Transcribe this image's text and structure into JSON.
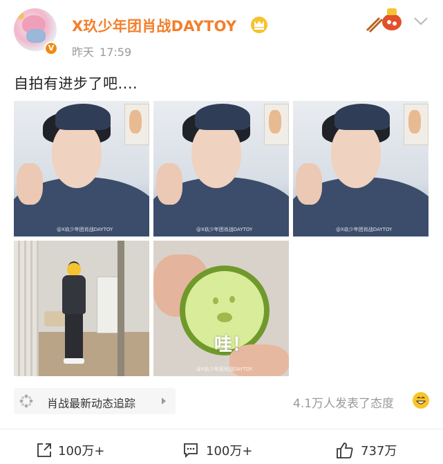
{
  "post": {
    "author": "X玖少年团肖战DAYTOY",
    "verified_badge": "V",
    "date": "昨天",
    "time": "17:59",
    "text": "自拍有进步了吧....",
    "images": [
      {
        "caption": "@X玖少年团肖战DAYTOY"
      },
      {
        "caption": "@X玖少年团肖战DAYTOY"
      },
      {
        "caption": "@X玖少年团肖战DAYTOY"
      },
      {
        "caption": ""
      },
      {
        "caption": "@X玖少年团肖战DAYTOY",
        "overlay_text": "哇！"
      }
    ]
  },
  "topic": {
    "label": "肖战最新动态追踪",
    "icon": "pinwheel-icon"
  },
  "reactions": {
    "text": "4.1万人发表了态度",
    "icon": "smile-emoji-icon"
  },
  "actions": {
    "repost_count": "100万+",
    "comment_count": "100万+",
    "like_count": "737万"
  },
  "colors": {
    "username": "#f37f2b",
    "badge": "#f08a13",
    "muted_text": "#999999"
  }
}
